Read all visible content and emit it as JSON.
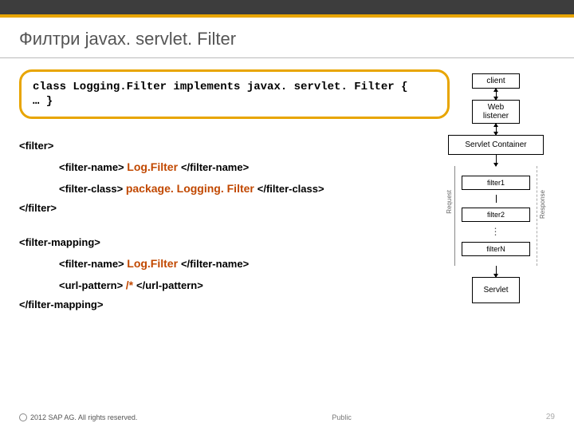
{
  "title": "Филтри javax. servlet. Filter",
  "code": {
    "line1": "class Logging.Filter implements javax. servlet. Filter {",
    "line2": "… }"
  },
  "xml": {
    "filter_open": "<filter>",
    "filter_name_open": "<filter-name> ",
    "filter_name_value": "Log.Filter ",
    "filter_name_close": "</filter-name>",
    "filter_class_open": "<filter-class> ",
    "filter_class_value": "package. Logging. Filter ",
    "filter_class_close": "</filter-class>",
    "filter_close": "</filter>",
    "mapping_open": "<filter-mapping>",
    "mapping_name_open": "<filter-name> ",
    "mapping_name_value": "Log.Filter ",
    "mapping_name_close": "</filter-name>",
    "url_open": "<url-pattern> ",
    "url_value": "/* ",
    "url_close": "</url-pattern>",
    "mapping_close": "</filter-mapping>"
  },
  "diagram": {
    "client": "client",
    "web_listener": "Web\nlistener",
    "servlet_container": "Servlet Container",
    "request_label": "Request",
    "response_label": "Response",
    "filter1": "filter1",
    "filter2": "filter2",
    "filterN": "filterN",
    "servlet": "Servlet"
  },
  "footer": {
    "copyright": "2012 SAP AG. All rights reserved.",
    "public": "Public",
    "page": "29"
  }
}
